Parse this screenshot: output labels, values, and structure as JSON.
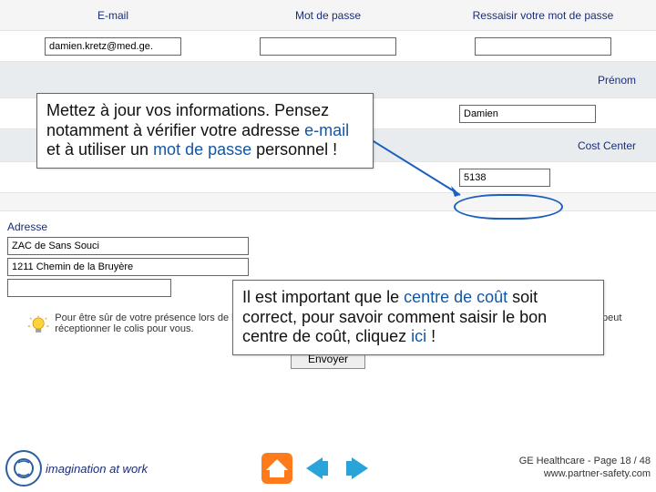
{
  "emailRow": {
    "emailLabel": "E-mail",
    "pwdLabel": "Mot de passe",
    "pwd2Label": "Ressaisir votre mot de passe"
  },
  "emailInputs": {
    "email": "damien.kretz@med.ge.",
    "pwd": "",
    "pwd2": ""
  },
  "nameRow": {
    "lastnameLabel": "Prénom",
    "lastnameValue": "Damien"
  },
  "ccRow": {
    "ccLabel": "Cost Center",
    "ccValue": "5138"
  },
  "addr": {
    "label": "Adresse",
    "line1": "ZAC de Sans Souci",
    "line2": "1211 Chemin de la Bruyère",
    "line3": ""
  },
  "bubble1": {
    "t1": "Mettez à jour vos informations. Pensez notamment à vérifier votre adresse ",
    "kw1": "e-mail",
    "t2": " et à utiliser un ",
    "kw2": "mot de passe",
    "t3": " personnel !"
  },
  "bubble2": {
    "t1": "Il est important que le ",
    "kw1": "centre de coût",
    "t2": " soit correct, pour savoir comment saisir le bon centre de coût, cliquez ",
    "kw2": "ici",
    "t3": " !"
  },
  "tip": "Pour être sûr de votre présence lors de la livraison, pensez à vous faire livrer sur votre lieu de travail ou chez quelqu'un qui peut réceptionner le colis pour vous.",
  "submit": "Envoyer",
  "footer": {
    "slogan": "imagination at work",
    "line1": "GE Healthcare - Page 18 / 48",
    "line2": "www.partner-safety.com"
  }
}
